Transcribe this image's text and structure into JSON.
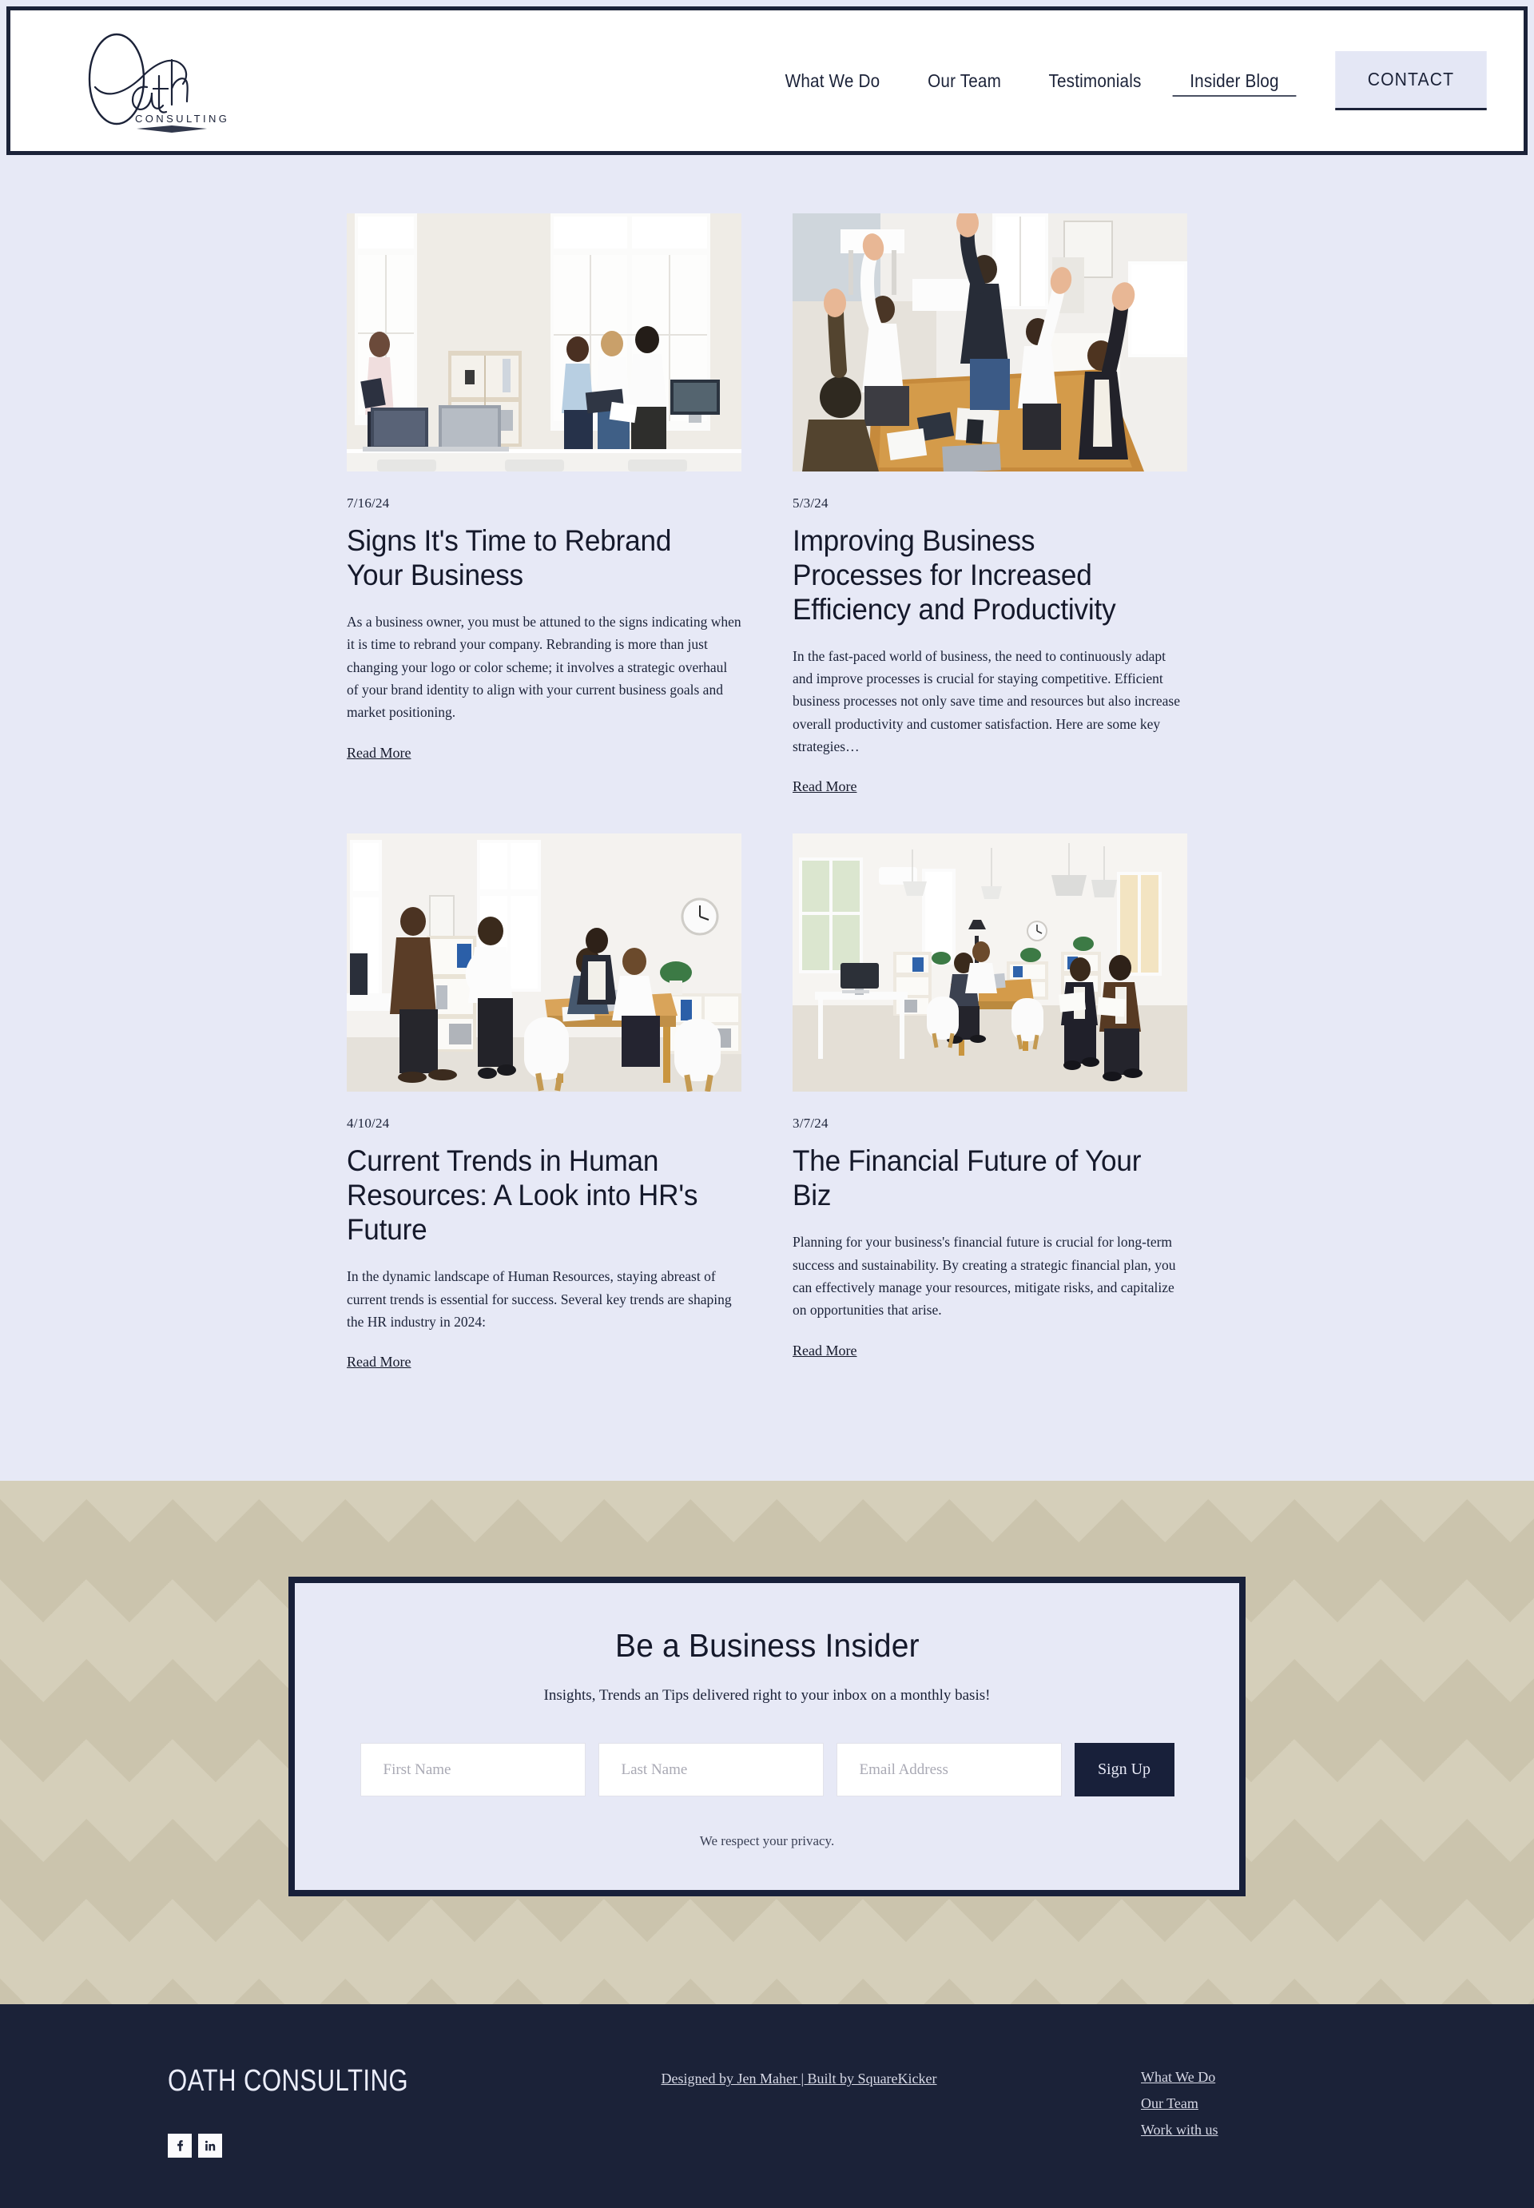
{
  "brand": {
    "logo_word": "Oath",
    "logo_sub": "CONSULTING",
    "footer_name": "OATH CONSULTING"
  },
  "nav": {
    "items": [
      {
        "label": "What We Do",
        "active": false
      },
      {
        "label": "Our Team",
        "active": false
      },
      {
        "label": "Testimonials",
        "active": false
      },
      {
        "label": "Insider Blog",
        "active": true
      }
    ],
    "contact_label": "CONTACT"
  },
  "blog": {
    "read_more_label": "Read More",
    "posts": [
      {
        "date": "7/16/24",
        "title": "Signs It's Time to Rebrand Your Business",
        "excerpt": "As a business owner, you must be attuned to the signs indicating when it is time to rebrand your company. Rebranding is more than just changing your logo or color scheme; it involves a strategic overhaul of your brand identity to align with your current business goals and market positioning.",
        "read_more": "Read More",
        "image_alt": "Four colleagues reviewing documents in a bright office with tall windows and laptops on a white desk"
      },
      {
        "date": "5/3/24",
        "title": "Improving Business Processes for Increased Efficiency and Productivity",
        "excerpt": "In the fast-paced world of business, the need to continuously adapt and improve processes is crucial for staying competitive. Efficient business processes not only save time and resources but also increase overall productivity and customer satisfaction. Here are some key strategies…",
        "read_more": "Read More",
        "image_alt": "Overhead view of a team raising their hands in celebration around a wooden meeting table"
      },
      {
        "date": "4/10/24",
        "title": "Current Trends in Human Resources: A Look into HR's Future",
        "excerpt": "In the dynamic landscape of Human Resources, staying abreast of current trends is essential for success. Several key trends are shaping the HR industry in 2024:",
        "read_more": "Read More",
        "image_alt": "Office team chatting around a wooden table with white chairs and a wall clock"
      },
      {
        "date": "3/7/24",
        "title": "The Financial Future of Your Biz",
        "excerpt": "Planning for your business's financial future is crucial for long-term success and sustainability. By creating a strategic financial plan, you can effectively manage your resources, mitigate risks, and capitalize on opportunities that arise.",
        "read_more": "Read More",
        "image_alt": "Spacious white office with pendant lamps, a wooden table and two people walking with papers"
      }
    ]
  },
  "newsletter": {
    "title": "Be a Business Insider",
    "subtitle": "Insights, Trends an Tips delivered right to your inbox on a monthly basis!",
    "first_name_placeholder": "First Name",
    "last_name_placeholder": "Last Name",
    "email_placeholder": "Email Address",
    "first_name_value": "",
    "last_name_value": "",
    "email_value": "",
    "submit_label": "Sign Up",
    "privacy_note": "We respect your privacy."
  },
  "footer": {
    "credit": "Designed by Jen Maher | Built by SquareKicker",
    "links": [
      {
        "label": "What We Do"
      },
      {
        "label": "Our Team"
      },
      {
        "label": "Work with us"
      }
    ],
    "social": [
      {
        "name": "facebook-icon",
        "glyph": "f"
      },
      {
        "name": "linkedin-icon",
        "glyph": "in"
      }
    ]
  },
  "colors": {
    "navy": "#1b2238",
    "lavender": "#e7e9f6",
    "tan": "#cbc4ad",
    "tan_light": "#d5cfba",
    "white": "#ffffff"
  }
}
